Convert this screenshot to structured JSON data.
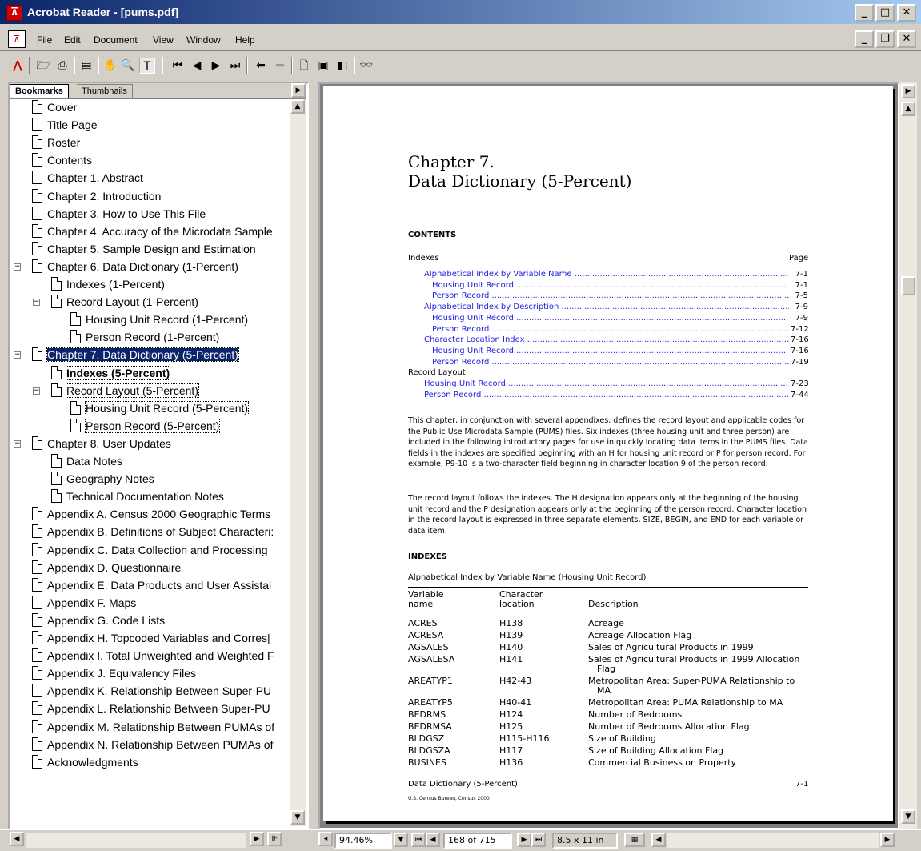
{
  "window": {
    "title": "Acrobat Reader - [pums.pdf]"
  },
  "menu": [
    "File",
    "Edit",
    "Document",
    "View",
    "Window",
    "Help"
  ],
  "tabs": {
    "bookmarks": "Bookmarks",
    "thumbnails": "Thumbnails"
  },
  "bookmarks": [
    "Cover",
    "Title Page",
    "Roster",
    "Contents",
    "Chapter 1. Abstract",
    "Chapter 2. Introduction",
    "Chapter 3. How to Use This File",
    "Chapter 4. Accuracy of the Microdata Sample",
    "Chapter 5. Sample Design and Estimation",
    "Chapter 6. Data Dictionary (1-Percent)",
    "Indexes (1-Percent)",
    "Record Layout (1-Percent)",
    "Housing Unit Record (1-Percent)",
    "Person Record (1-Percent)",
    "Chapter 7. Data Dictionary (5-Percent)",
    "Indexes (5-Percent)",
    "Record Layout (5-Percent)",
    "Housing Unit Record (5-Percent)",
    "Person Record (5-Percent)",
    "Chapter 8. User Updates",
    "Data Notes",
    "Geography Notes",
    "Technical Documentation Notes",
    "Appendix A. Census 2000 Geographic Terms",
    "Appendix B. Definitions of Subject Characteri:",
    "Appendix C. Data Collection and Processing",
    "Appendix D. Questionnaire",
    "Appendix E. Data Products and User Assistai",
    "Appendix F. Maps",
    "Appendix G. Code Lists",
    "Appendix H. Topcoded Variables and Corres|",
    "Appendix I. Total Unweighted and Weighted F",
    "Appendix J. Equivalency Files",
    "Appendix K. Relationship Between Super-PU",
    "Appendix L. Relationship Between Super-PU",
    "Appendix M. Relationship Between PUMAs of",
    "Appendix N. Relationship Between PUMAs of",
    "Acknowledgments"
  ],
  "doc": {
    "chapter": "Chapter 7.",
    "title": "Data Dictionary (5-Percent)",
    "contents_heading": "CONTENTS",
    "indexes_label": "Indexes",
    "page_label": "Page",
    "toc": [
      {
        "text": "Alphabetical Index by Variable Name",
        "page": "7-1"
      },
      {
        "text": "Housing Unit Record",
        "page": "7-1"
      },
      {
        "text": "Person Record",
        "page": "7-5"
      },
      {
        "text": "Alphabetical Index by Description",
        "page": "7-9"
      },
      {
        "text": "Housing Unit Record",
        "page": "7-9"
      },
      {
        "text": "Person Record",
        "page": "7-12"
      },
      {
        "text": "Character Location Index",
        "page": "7-16"
      },
      {
        "text": "Housing Unit Record",
        "page": "7-16"
      },
      {
        "text": "Person Record",
        "page": "7-19"
      },
      {
        "text": "Record Layout",
        "page": ""
      },
      {
        "text": "Housing Unit Record",
        "page": "7-23"
      },
      {
        "text": "Person Record",
        "page": "7-44"
      }
    ],
    "para1": "This chapter, in conjunction with several appendixes, defines the record layout and applicable codes for the Public Use Microdata Sample (PUMS) files. Six indexes (three housing unit and three person) are included in the following introductory pages for use in quickly locating data items in the PUMS files. Data fields in the indexes are specified beginning with an H for housing unit record or P for person record. For example, P9-10 is a two-character field beginning in character location 9 of the person record.",
    "para2": "The record layout follows the indexes. The H designation appears only at the beginning of the housing unit record and the P designation appears only at the beginning of the person record. Character location in the record layout is expressed in three separate elements, SIZE, BEGIN, and END for each variable or data item.",
    "indexes_heading": "INDEXES",
    "table_caption": "Alphabetical Index by Variable Name (Housing Unit Record)",
    "col1a": "Variable",
    "col1b": "name",
    "col2a": "Character",
    "col2b": "location",
    "col3": "Description",
    "rows": [
      [
        "ACRES",
        "H138",
        "Acreage"
      ],
      [
        "ACRESA",
        "H139",
        "Acreage Allocation Flag"
      ],
      [
        "AGSALES",
        "H140",
        "Sales of Agricultural Products in 1999"
      ],
      [
        "AGSALESA",
        "H141",
        "Sales of Agricultural Products in 1999 Allocation"
      ],
      [
        "",
        "",
        "Flag"
      ],
      [
        "AREATYP1",
        "H42-43",
        "Metropolitan Area: Super-PUMA Relationship to"
      ],
      [
        "",
        "",
        "MA"
      ],
      [
        "AREATYP5",
        "H40-41",
        "Metropolitan Area: PUMA Relationship to MA"
      ],
      [
        "BEDRMS",
        "H124",
        "Number of Bedrooms"
      ],
      [
        "BEDRMSA",
        "H125",
        "Number of Bedrooms Allocation Flag"
      ],
      [
        "BLDGSZ",
        "H115-H116",
        "Size of Building"
      ],
      [
        "BLDGSZA",
        "H117",
        "Size of Building Allocation Flag"
      ],
      [
        "BUSINES",
        "H136",
        "Commercial Business on Property"
      ]
    ],
    "footer_left": "Data Dictionary (5-Percent)",
    "footer_right": "7-1",
    "footer_small": "U.S. Census Bureau, Census 2000"
  },
  "status": {
    "zoom": "94.46%",
    "page": "168 of 715",
    "size": "8.5 x 11 in"
  }
}
